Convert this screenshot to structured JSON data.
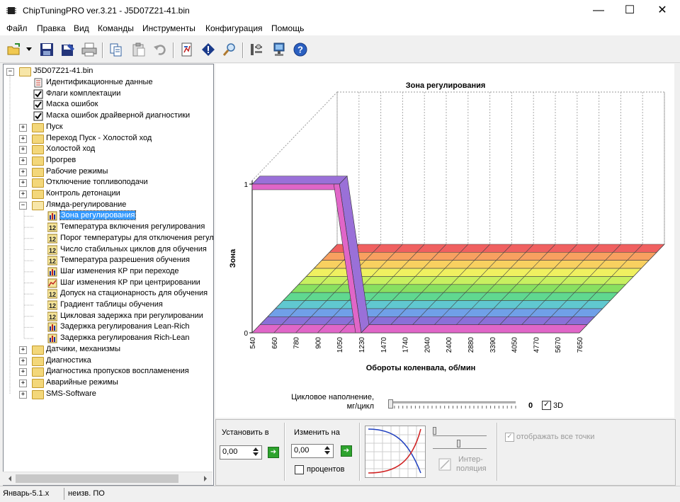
{
  "window": {
    "title": "ChipTuningPRO ver.3.21 - J5D07Z21-41.bin",
    "minimize": "—",
    "maximize": "☐",
    "close": "✕"
  },
  "menu": [
    "Файл",
    "Правка",
    "Вид",
    "Команды",
    "Инструменты",
    "Конфигурация",
    "Помощь"
  ],
  "toolbar_icons": [
    "open-icon",
    "save-icon",
    "save-as-icon",
    "print-icon",
    "copy-icon",
    "paste-icon",
    "undo-icon",
    "compare-icon",
    "checksum-icon",
    "search-icon",
    "settings-icon",
    "connect-icon",
    "help-icon"
  ],
  "tree": {
    "root": "J5D07Z21-41.bin",
    "items": [
      {
        "label": "Идентификационные данные",
        "icon": "doc",
        "level": 1
      },
      {
        "label": "Флаги комплектации",
        "icon": "check",
        "level": 1
      },
      {
        "label": "Маска ошибок",
        "icon": "check",
        "level": 1
      },
      {
        "label": "Маска ошибок драйверной диагностики",
        "icon": "check",
        "level": 1
      },
      {
        "label": "Пуск",
        "icon": "folder",
        "level": 1
      },
      {
        "label": "Переход Пуск - Холостой ход",
        "icon": "folder",
        "level": 1
      },
      {
        "label": "Холостой ход",
        "icon": "folder",
        "level": 1
      },
      {
        "label": "Прогрев",
        "icon": "folder",
        "level": 1
      },
      {
        "label": "Рабочие режимы",
        "icon": "folder",
        "level": 1
      },
      {
        "label": "Отключение топливоподачи",
        "icon": "folder",
        "level": 1
      },
      {
        "label": "Контроль детонации",
        "icon": "folder",
        "level": 1
      },
      {
        "label": "Лямда-регулирование",
        "icon": "folder-open",
        "level": 1
      },
      {
        "label": "Зона регулирования",
        "icon": "map",
        "level": 2,
        "selected": true
      },
      {
        "label": "Температура включения регулирования",
        "icon": "num",
        "level": 2
      },
      {
        "label": "Порог температуры для отключения регулирования",
        "icon": "num",
        "level": 2
      },
      {
        "label": "Число стабильных циклов для обучения",
        "icon": "num",
        "level": 2
      },
      {
        "label": "Температура разрешения обучения",
        "icon": "num",
        "level": 2
      },
      {
        "label": "Шаг изменения КР при переходе",
        "icon": "map",
        "level": 2
      },
      {
        "label": "Шаг изменения КР при центрировании",
        "icon": "curve",
        "level": 2
      },
      {
        "label": "Допуск на стационарность для обучения",
        "icon": "num",
        "level": 2
      },
      {
        "label": "Градиент таблицы обучения",
        "icon": "num",
        "level": 2
      },
      {
        "label": "Цикловая задержка при регулировании",
        "icon": "num",
        "level": 2
      },
      {
        "label": "Задержка регулирования Lean-Rich",
        "icon": "map",
        "level": 2
      },
      {
        "label": "Задержка регулирования Rich-Lean",
        "icon": "map",
        "level": 2
      },
      {
        "label": "Датчики, механизмы",
        "icon": "folder",
        "level": 1
      },
      {
        "label": "Диагностика",
        "icon": "folder",
        "level": 1
      },
      {
        "label": "Диагностика пропусков воспламенения",
        "icon": "folder",
        "level": 1
      },
      {
        "label": "Аварийные режимы",
        "icon": "folder",
        "level": 1
      },
      {
        "label": "SMS-Software",
        "icon": "folder",
        "level": 1
      }
    ]
  },
  "chart_data": {
    "type": "3d-surface",
    "title": "Зона регулирования",
    "xlabel": "Обороты коленвала, об/мин",
    "ylabel": "Зона",
    "x_ticks": [
      "540",
      "660",
      "780",
      "900",
      "1050",
      "1230",
      "1470",
      "1740",
      "2040",
      "2400",
      "2880",
      "3390",
      "4050",
      "4770",
      "5670",
      "7650"
    ],
    "z_ticks": [
      "0",
      "1"
    ],
    "front_row_values": [
      1,
      1,
      1,
      1,
      1,
      0,
      0,
      0,
      0,
      0,
      0,
      0,
      0,
      0,
      0,
      0
    ],
    "band_colors": [
      "#e066c8",
      "#8a70d8",
      "#70a0e8",
      "#60c8d0",
      "#60d890",
      "#88e060",
      "#c8f060",
      "#f0f060",
      "#f8d060",
      "#f8a060",
      "#f06060"
    ]
  },
  "load": {
    "label_line1": "Цикловое наполнение,",
    "label_line2": "мг/цикл",
    "value": "0",
    "checkbox_label": "3D",
    "checked_mark": "✓"
  },
  "controls": {
    "set_label": "Установить в",
    "set_value": "0,00",
    "change_label": "Изменить на",
    "change_value": "0,00",
    "percent_label": "процентов",
    "interp_label_1": "Интер-",
    "interp_label_2": "поляция",
    "show_points_label": "отображать все точки",
    "apply_arrow": "➔"
  },
  "status": {
    "left": "Январь-5.1.x",
    "right": "неизв. ПО"
  }
}
